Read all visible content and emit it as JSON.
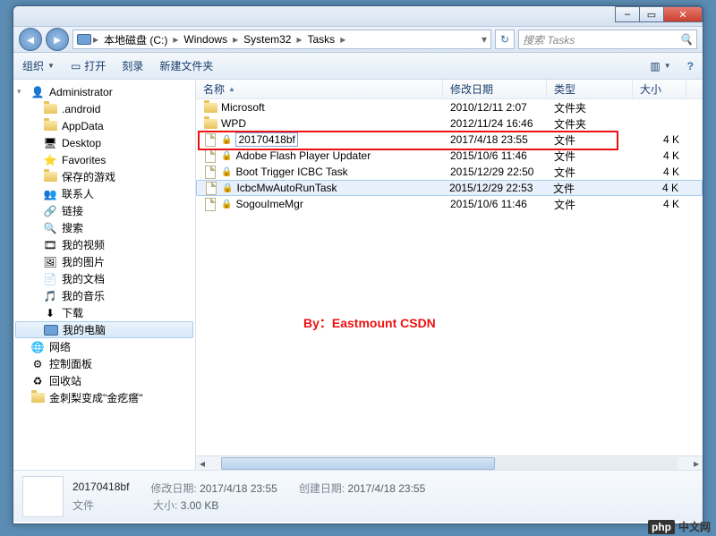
{
  "window_buttons": {
    "min": "–",
    "max": "▭",
    "close": "✕"
  },
  "nav_arrows": {
    "back": "◄",
    "fwd": "►"
  },
  "breadcrumb": {
    "icon": "pc",
    "segments": [
      "本地磁盘 (C:)",
      "Windows",
      "System32",
      "Tasks"
    ]
  },
  "refresh_glyph": "↻",
  "search": {
    "placeholder": "搜索 Tasks",
    "icon": "🔍"
  },
  "toolbar": {
    "organize": "组织",
    "open": "打开",
    "burn": "刻录",
    "newfolder": "新建文件夹",
    "view_icon": "▥",
    "help_icon": "?"
  },
  "tree": [
    {
      "lv": 0,
      "chev": "▾",
      "icon": "user",
      "label": "Administrator"
    },
    {
      "lv": 1,
      "icon": "folder",
      "label": ".android"
    },
    {
      "lv": 1,
      "icon": "folder",
      "label": "AppData"
    },
    {
      "lv": 1,
      "icon": "desktop",
      "label": "Desktop"
    },
    {
      "lv": 1,
      "icon": "fav",
      "label": "Favorites"
    },
    {
      "lv": 1,
      "icon": "folder",
      "label": "保存的游戏"
    },
    {
      "lv": 1,
      "icon": "contacts",
      "label": "联系人"
    },
    {
      "lv": 1,
      "icon": "link",
      "label": "链接"
    },
    {
      "lv": 1,
      "icon": "search",
      "label": "搜索"
    },
    {
      "lv": 1,
      "icon": "video",
      "label": "我的视频"
    },
    {
      "lv": 1,
      "icon": "pic",
      "label": "我的图片"
    },
    {
      "lv": 1,
      "icon": "doc",
      "label": "我的文档"
    },
    {
      "lv": 1,
      "icon": "music",
      "label": "我的音乐"
    },
    {
      "lv": 1,
      "icon": "dl",
      "label": "下载"
    },
    {
      "lv": 0,
      "sel": true,
      "icon": "pc",
      "label": "我的电脑"
    },
    {
      "lv": 0,
      "icon": "net",
      "label": "网络"
    },
    {
      "lv": 0,
      "icon": "cpl",
      "label": "控制面板"
    },
    {
      "lv": 0,
      "icon": "recycle",
      "label": "回收站"
    },
    {
      "lv": 0,
      "icon": "folder",
      "label": "金刺梨变成\"金疙瘩\""
    }
  ],
  "columns": {
    "name": "名称",
    "date": "修改日期",
    "type": "类型",
    "size": "大小"
  },
  "rows": [
    {
      "icon": "folder",
      "lock": false,
      "name": "Microsoft",
      "date": "2010/12/11 2:07",
      "type": "文件夹",
      "size": ""
    },
    {
      "icon": "folder",
      "lock": false,
      "name": "WPD",
      "date": "2012/11/24 16:46",
      "type": "文件夹",
      "size": ""
    },
    {
      "icon": "file",
      "lock": true,
      "name": "20170418bf",
      "edit": true,
      "date": "2017/4/18 23:55",
      "type": "文件",
      "size": "4 K"
    },
    {
      "icon": "file",
      "lock": true,
      "name": "Adobe Flash Player Updater",
      "date": "2015/10/6 11:46",
      "type": "文件",
      "size": "4 K"
    },
    {
      "icon": "file",
      "lock": true,
      "name": "Boot Trigger ICBC Task",
      "date": "2015/12/29 22:50",
      "type": "文件",
      "size": "4 K"
    },
    {
      "icon": "file",
      "lock": true,
      "name": "IcbcMwAutoRunTask",
      "hl": true,
      "date": "2015/12/29 22:53",
      "type": "文件",
      "size": "4 K"
    },
    {
      "icon": "file",
      "lock": true,
      "name": "SogouImeMgr",
      "date": "2015/10/6 11:46",
      "type": "文件",
      "size": "4 K"
    }
  ],
  "watermark": "By：Eastmount CSDN",
  "details": {
    "filename": "20170418bf",
    "type": "文件",
    "mod_label": "修改日期:",
    "mod_value": "2017/4/18 23:55",
    "create_label": "创建日期:",
    "create_value": "2017/4/18 23:55",
    "size_label": "大小:",
    "size_value": "3.00 KB"
  },
  "brand": {
    "php": "php",
    "cn": "中文网"
  }
}
